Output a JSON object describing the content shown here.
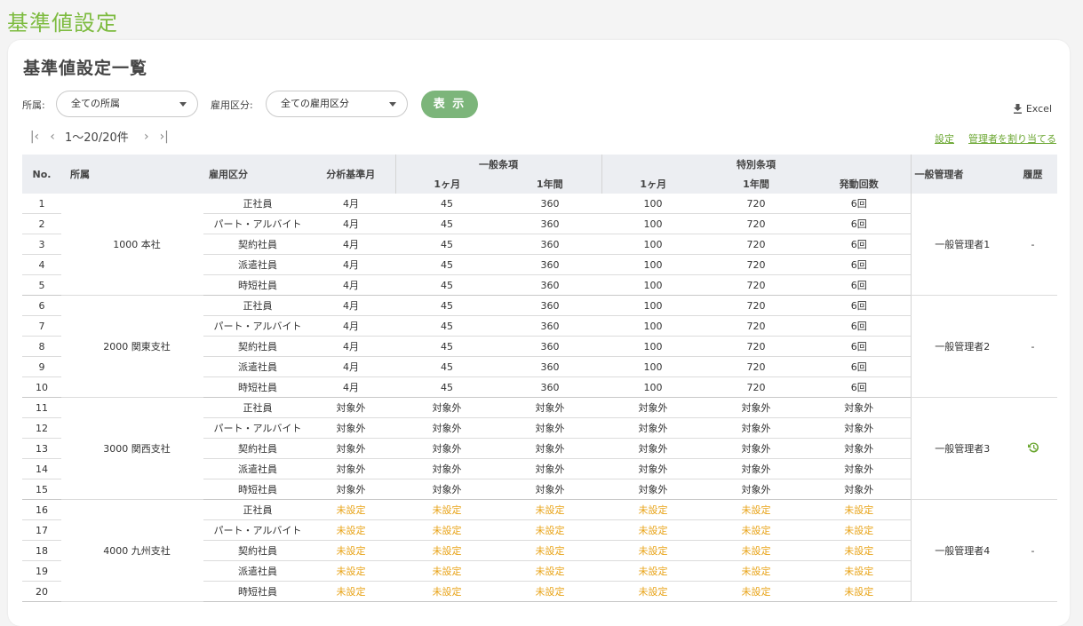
{
  "page": {
    "title": "基準値設定"
  },
  "card": {
    "title": "基準値設定一覧"
  },
  "filters": {
    "dept_label": "所属:",
    "dept_value": "全ての所属",
    "emp_label": "雇用区分:",
    "emp_value": "全ての雇用区分",
    "show_label": "表 示"
  },
  "toolbar": {
    "excel_label": "Excel",
    "pager_text": "1〜20/20件",
    "settings_link": "設定",
    "assign_link": "管理者を割り当てる"
  },
  "table": {
    "headers": {
      "no": "No.",
      "dept": "所属",
      "emp": "雇用区分",
      "base_month": "分析基準月",
      "general": "一般条項",
      "special": "特別条項",
      "month1": "1ヶ月",
      "year1": "1年間",
      "count": "発動回数",
      "manager": "一般管理者",
      "history": "履歴"
    },
    "groups": [
      {
        "dept": "1000 本社",
        "manager": "一般管理者1",
        "history": "-",
        "rows": [
          {
            "no": "1",
            "emp": "正社員",
            "base": "4月",
            "g1": "45",
            "gy": "360",
            "s1": "100",
            "sy": "720",
            "cnt": "6回"
          },
          {
            "no": "2",
            "emp": "パート・アルバイト",
            "base": "4月",
            "g1": "45",
            "gy": "360",
            "s1": "100",
            "sy": "720",
            "cnt": "6回"
          },
          {
            "no": "3",
            "emp": "契約社員",
            "base": "4月",
            "g1": "45",
            "gy": "360",
            "s1": "100",
            "sy": "720",
            "cnt": "6回"
          },
          {
            "no": "4",
            "emp": "派遣社員",
            "base": "4月",
            "g1": "45",
            "gy": "360",
            "s1": "100",
            "sy": "720",
            "cnt": "6回"
          },
          {
            "no": "5",
            "emp": "時短社員",
            "base": "4月",
            "g1": "45",
            "gy": "360",
            "s1": "100",
            "sy": "720",
            "cnt": "6回"
          }
        ]
      },
      {
        "dept": "2000 関東支社",
        "manager": "一般管理者2",
        "history": "-",
        "rows": [
          {
            "no": "6",
            "emp": "正社員",
            "base": "4月",
            "g1": "45",
            "gy": "360",
            "s1": "100",
            "sy": "720",
            "cnt": "6回"
          },
          {
            "no": "7",
            "emp": "パート・アルバイト",
            "base": "4月",
            "g1": "45",
            "gy": "360",
            "s1": "100",
            "sy": "720",
            "cnt": "6回"
          },
          {
            "no": "8",
            "emp": "契約社員",
            "base": "4月",
            "g1": "45",
            "gy": "360",
            "s1": "100",
            "sy": "720",
            "cnt": "6回"
          },
          {
            "no": "9",
            "emp": "派遣社員",
            "base": "4月",
            "g1": "45",
            "gy": "360",
            "s1": "100",
            "sy": "720",
            "cnt": "6回"
          },
          {
            "no": "10",
            "emp": "時短社員",
            "base": "4月",
            "g1": "45",
            "gy": "360",
            "s1": "100",
            "sy": "720",
            "cnt": "6回"
          }
        ]
      },
      {
        "dept": "3000 関西支社",
        "manager": "一般管理者3",
        "history": "history-icon",
        "rows": [
          {
            "no": "11",
            "emp": "正社員",
            "base": "対象外",
            "g1": "対象外",
            "gy": "対象外",
            "s1": "対象外",
            "sy": "対象外",
            "cnt": "対象外"
          },
          {
            "no": "12",
            "emp": "パート・アルバイト",
            "base": "対象外",
            "g1": "対象外",
            "gy": "対象外",
            "s1": "対象外",
            "sy": "対象外",
            "cnt": "対象外"
          },
          {
            "no": "13",
            "emp": "契約社員",
            "base": "対象外",
            "g1": "対象外",
            "gy": "対象外",
            "s1": "対象外",
            "sy": "対象外",
            "cnt": "対象外"
          },
          {
            "no": "14",
            "emp": "派遣社員",
            "base": "対象外",
            "g1": "対象外",
            "gy": "対象外",
            "s1": "対象外",
            "sy": "対象外",
            "cnt": "対象外"
          },
          {
            "no": "15",
            "emp": "時短社員",
            "base": "対象外",
            "g1": "対象外",
            "gy": "対象外",
            "s1": "対象外",
            "sy": "対象外",
            "cnt": "対象外"
          }
        ]
      },
      {
        "dept": "4000 九州支社",
        "manager": "一般管理者4",
        "history": "-",
        "rows": [
          {
            "no": "16",
            "emp": "正社員",
            "base": "未設定",
            "g1": "未設定",
            "gy": "未設定",
            "s1": "未設定",
            "sy": "未設定",
            "cnt": "未設定",
            "unset": true
          },
          {
            "no": "17",
            "emp": "パート・アルバイト",
            "base": "未設定",
            "g1": "未設定",
            "gy": "未設定",
            "s1": "未設定",
            "sy": "未設定",
            "cnt": "未設定",
            "unset": true
          },
          {
            "no": "18",
            "emp": "契約社員",
            "base": "未設定",
            "g1": "未設定",
            "gy": "未設定",
            "s1": "未設定",
            "sy": "未設定",
            "cnt": "未設定",
            "unset": true
          },
          {
            "no": "19",
            "emp": "派遣社員",
            "base": "未設定",
            "g1": "未設定",
            "gy": "未設定",
            "s1": "未設定",
            "sy": "未設定",
            "cnt": "未設定",
            "unset": true
          },
          {
            "no": "20",
            "emp": "時短社員",
            "base": "未設定",
            "g1": "未設定",
            "gy": "未設定",
            "s1": "未設定",
            "sy": "未設定",
            "cnt": "未設定",
            "unset": true
          }
        ]
      }
    ]
  },
  "colors": {
    "accent_green": "#7dbb3f",
    "unset_orange": "#e8a317",
    "button_green": "#7cb57a"
  }
}
